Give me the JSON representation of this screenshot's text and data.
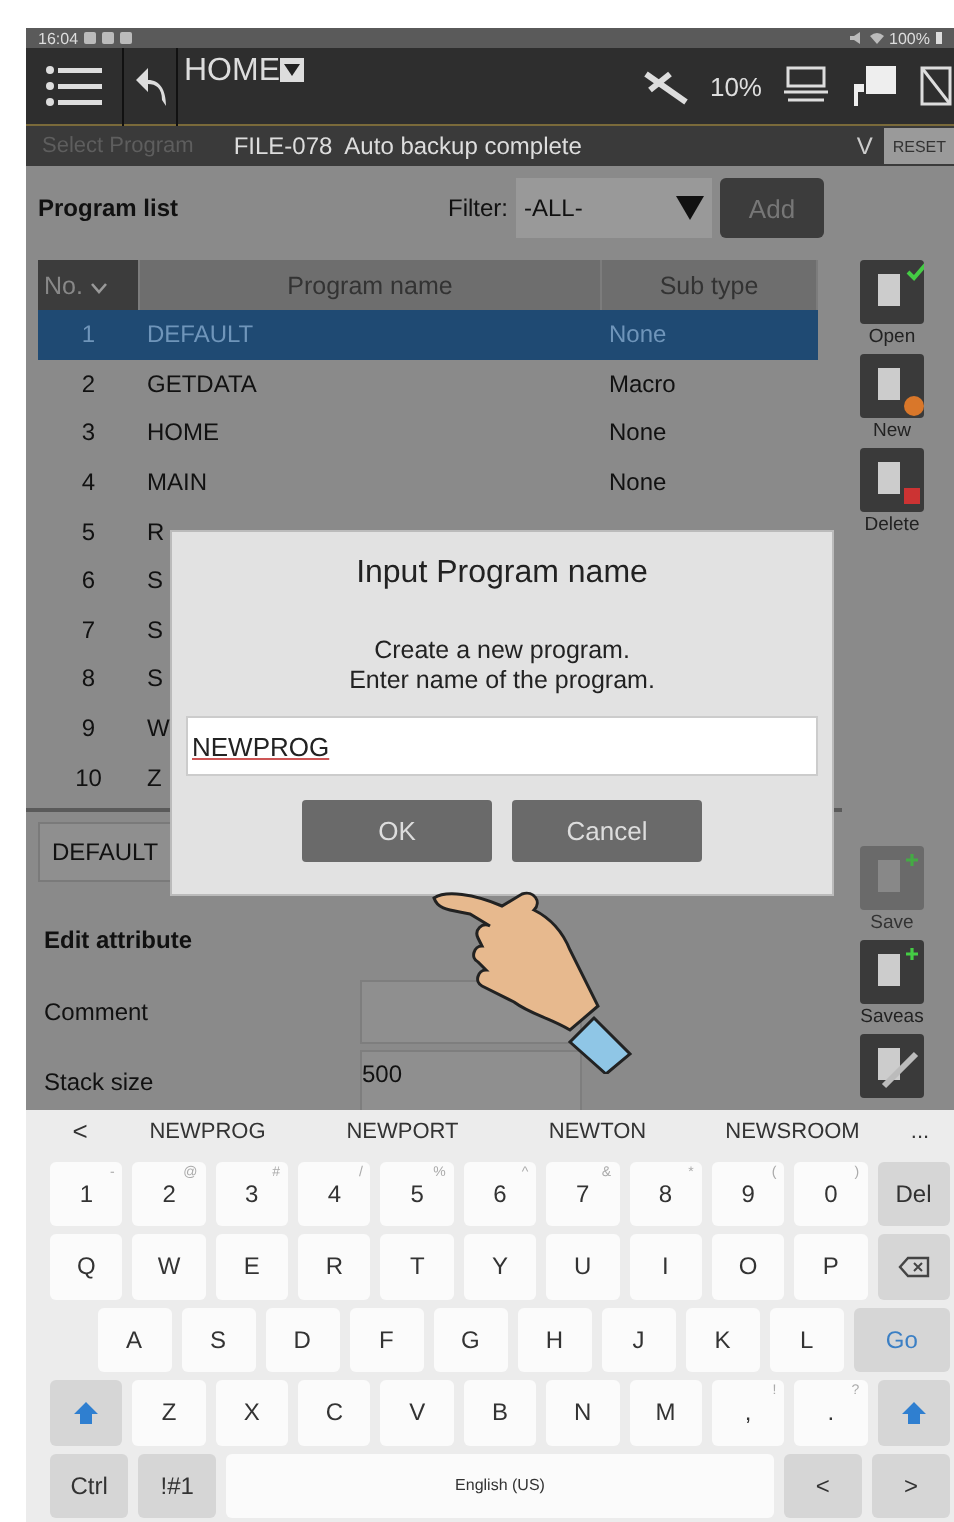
{
  "status_bar": {
    "time": "16:04",
    "battery": "100%"
  },
  "toolbar": {
    "title": "HOME",
    "speed": "10%"
  },
  "message_bar": {
    "label": "Select Program",
    "message": "FILE-078  Auto backup complete",
    "expand": "V",
    "reset": "RESET"
  },
  "program_list": {
    "title": "Program list",
    "filter_label": "Filter:",
    "filter_value": "-ALL-",
    "add": "Add",
    "columns": [
      {
        "label": "No.",
        "sorted": true
      },
      {
        "label": "Program name",
        "sorted": false
      },
      {
        "label": "Sub type",
        "sorted": false
      }
    ],
    "rows": [
      {
        "no": "1",
        "name": "DEFAULT",
        "sub_type": "None",
        "selected": true
      },
      {
        "no": "2",
        "name": "GETDATA",
        "sub_type": "Macro",
        "selected": false
      },
      {
        "no": "3",
        "name": "HOME",
        "sub_type": "None",
        "selected": false
      },
      {
        "no": "4",
        "name": "MAIN",
        "sub_type": "None",
        "selected": false
      },
      {
        "no": "5",
        "name": "R",
        "selected": false
      },
      {
        "no": "6",
        "name": "S",
        "selected": false
      },
      {
        "no": "7",
        "name": "S",
        "selected": false
      },
      {
        "no": "8",
        "name": "S",
        "selected": false
      },
      {
        "no": "9",
        "name": "W",
        "selected": false
      },
      {
        "no": "10",
        "name": "Z",
        "selected": false
      }
    ]
  },
  "side_buttons": [
    {
      "kind": "open",
      "label": "Open",
      "disabled": false
    },
    {
      "kind": "new",
      "label": "New",
      "disabled": false
    },
    {
      "kind": "delete",
      "label": "Delete",
      "disabled": false
    },
    {
      "kind": "save",
      "label": "Save",
      "disabled": true
    },
    {
      "kind": "saveas",
      "label": "Saveas",
      "disabled": false
    },
    {
      "kind": "name",
      "disabled": false
    }
  ],
  "current_program": "DEFAULT",
  "edit_attribute": {
    "title": "Edit attribute",
    "fields": [
      {
        "label": "Comment"
      },
      {
        "label": "Stack size",
        "value": "500"
      }
    ]
  },
  "dialog": {
    "title": "Input Program name",
    "message_lines": [
      "Create a new program.",
      "Enter name of the program."
    ],
    "value": "NEWPROG",
    "buttons": [
      "OK",
      "Cancel"
    ]
  },
  "keyboard": {
    "back": "<",
    "suggestions": [
      "NEWPROG",
      "NEWPORT",
      "NEWTON",
      "NEWSROOM"
    ],
    "more": "...",
    "rows": [
      {
        "keys": [
          {
            "kind": "char",
            "label": "1",
            "hint": "-"
          },
          {
            "kind": "char",
            "label": "2",
            "hint": "@"
          },
          {
            "kind": "char",
            "label": "3",
            "hint": "#"
          },
          {
            "kind": "char",
            "label": "4",
            "hint": "/"
          },
          {
            "kind": "char",
            "label": "5",
            "hint": "%"
          },
          {
            "kind": "char",
            "label": "6",
            "hint": "^"
          },
          {
            "kind": "char",
            "label": "7",
            "hint": "&"
          },
          {
            "kind": "char",
            "label": "8",
            "hint": "*"
          },
          {
            "kind": "char",
            "label": "9",
            "hint": "("
          },
          {
            "kind": "char",
            "label": "0",
            "hint": ")"
          },
          {
            "kind": "function",
            "label": "Del"
          }
        ]
      },
      {
        "keys": [
          {
            "kind": "char",
            "label": "Q"
          },
          {
            "kind": "char",
            "label": "W"
          },
          {
            "kind": "char",
            "label": "E"
          },
          {
            "kind": "char",
            "label": "R"
          },
          {
            "kind": "char",
            "label": "T"
          },
          {
            "kind": "char",
            "label": "Y"
          },
          {
            "kind": "char",
            "label": "U"
          },
          {
            "kind": "char",
            "label": "I"
          },
          {
            "kind": "char",
            "label": "O"
          },
          {
            "kind": "char",
            "label": "P"
          },
          {
            "kind": "backspace"
          }
        ]
      },
      {
        "keys": [
          {
            "kind": "gap"
          },
          {
            "kind": "char",
            "label": "A"
          },
          {
            "kind": "char",
            "label": "S"
          },
          {
            "kind": "char",
            "label": "D"
          },
          {
            "kind": "char",
            "label": "F"
          },
          {
            "kind": "char",
            "label": "G"
          },
          {
            "kind": "char",
            "label": "H"
          },
          {
            "kind": "char",
            "label": "J"
          },
          {
            "kind": "char",
            "label": "K"
          },
          {
            "kind": "char",
            "label": "L"
          },
          {
            "kind": "go",
            "label": "Go"
          }
        ]
      },
      {
        "keys": [
          {
            "kind": "shift"
          },
          {
            "kind": "char",
            "label": "Z"
          },
          {
            "kind": "char",
            "label": "X"
          },
          {
            "kind": "char",
            "label": "C"
          },
          {
            "kind": "char",
            "label": "V"
          },
          {
            "kind": "char",
            "label": "B"
          },
          {
            "kind": "char",
            "label": "N"
          },
          {
            "kind": "char",
            "label": "M"
          },
          {
            "kind": "char",
            "label": ",",
            "hint": "!"
          },
          {
            "kind": "char",
            "label": ".",
            "hint": "?"
          },
          {
            "kind": "shift"
          }
        ]
      },
      {
        "keys": [
          {
            "kind": "function",
            "label": "Ctrl"
          },
          {
            "kind": "function",
            "label": "!#1"
          },
          {
            "kind": "space",
            "label": "English (US)"
          },
          {
            "kind": "function",
            "label": "<"
          },
          {
            "kind": "function",
            "label": ">"
          }
        ]
      }
    ]
  }
}
